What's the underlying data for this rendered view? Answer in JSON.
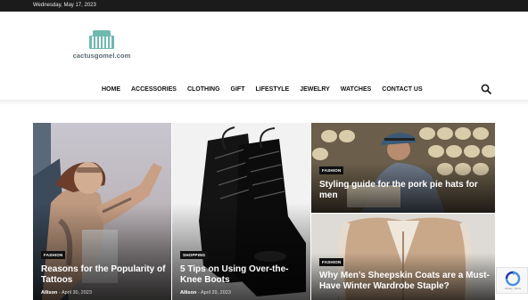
{
  "topbar": {
    "date": "Wednesday, May 17, 2023"
  },
  "logo": {
    "text": "cactusgomel.com"
  },
  "nav": {
    "items": [
      "HOME",
      "ACCESSORIES",
      "CLOTHING",
      "GIFT",
      "LIFESTYLE",
      "JEWELRY",
      "WATCHES",
      "CONTACT US"
    ],
    "active": "HOME"
  },
  "icons": {
    "search": "search-icon",
    "recaptcha": "recaptcha-icon"
  },
  "colors": {
    "accent": "#4db2ec",
    "topbar": "#1b1b1b"
  },
  "posts": [
    {
      "tag": "FASHION",
      "title": "Reasons for the Popularity of Tattoos",
      "author": "Allison",
      "date": "April 30, 2023"
    },
    {
      "tag": "SHOPPING",
      "title": "5 Tips on Using Over-the-Knee Boots",
      "author": "Allison",
      "date": "April 29, 2023"
    },
    {
      "tag": "FASHION",
      "title": "Styling guide for the pork pie hats for men"
    },
    {
      "tag": "FASHION",
      "title": "Why Men’s Sheepskin Coats are a Must-Have Winter Wardrobe Staple?"
    }
  ],
  "recaptcha": {
    "text": "Privacy - Terms"
  }
}
